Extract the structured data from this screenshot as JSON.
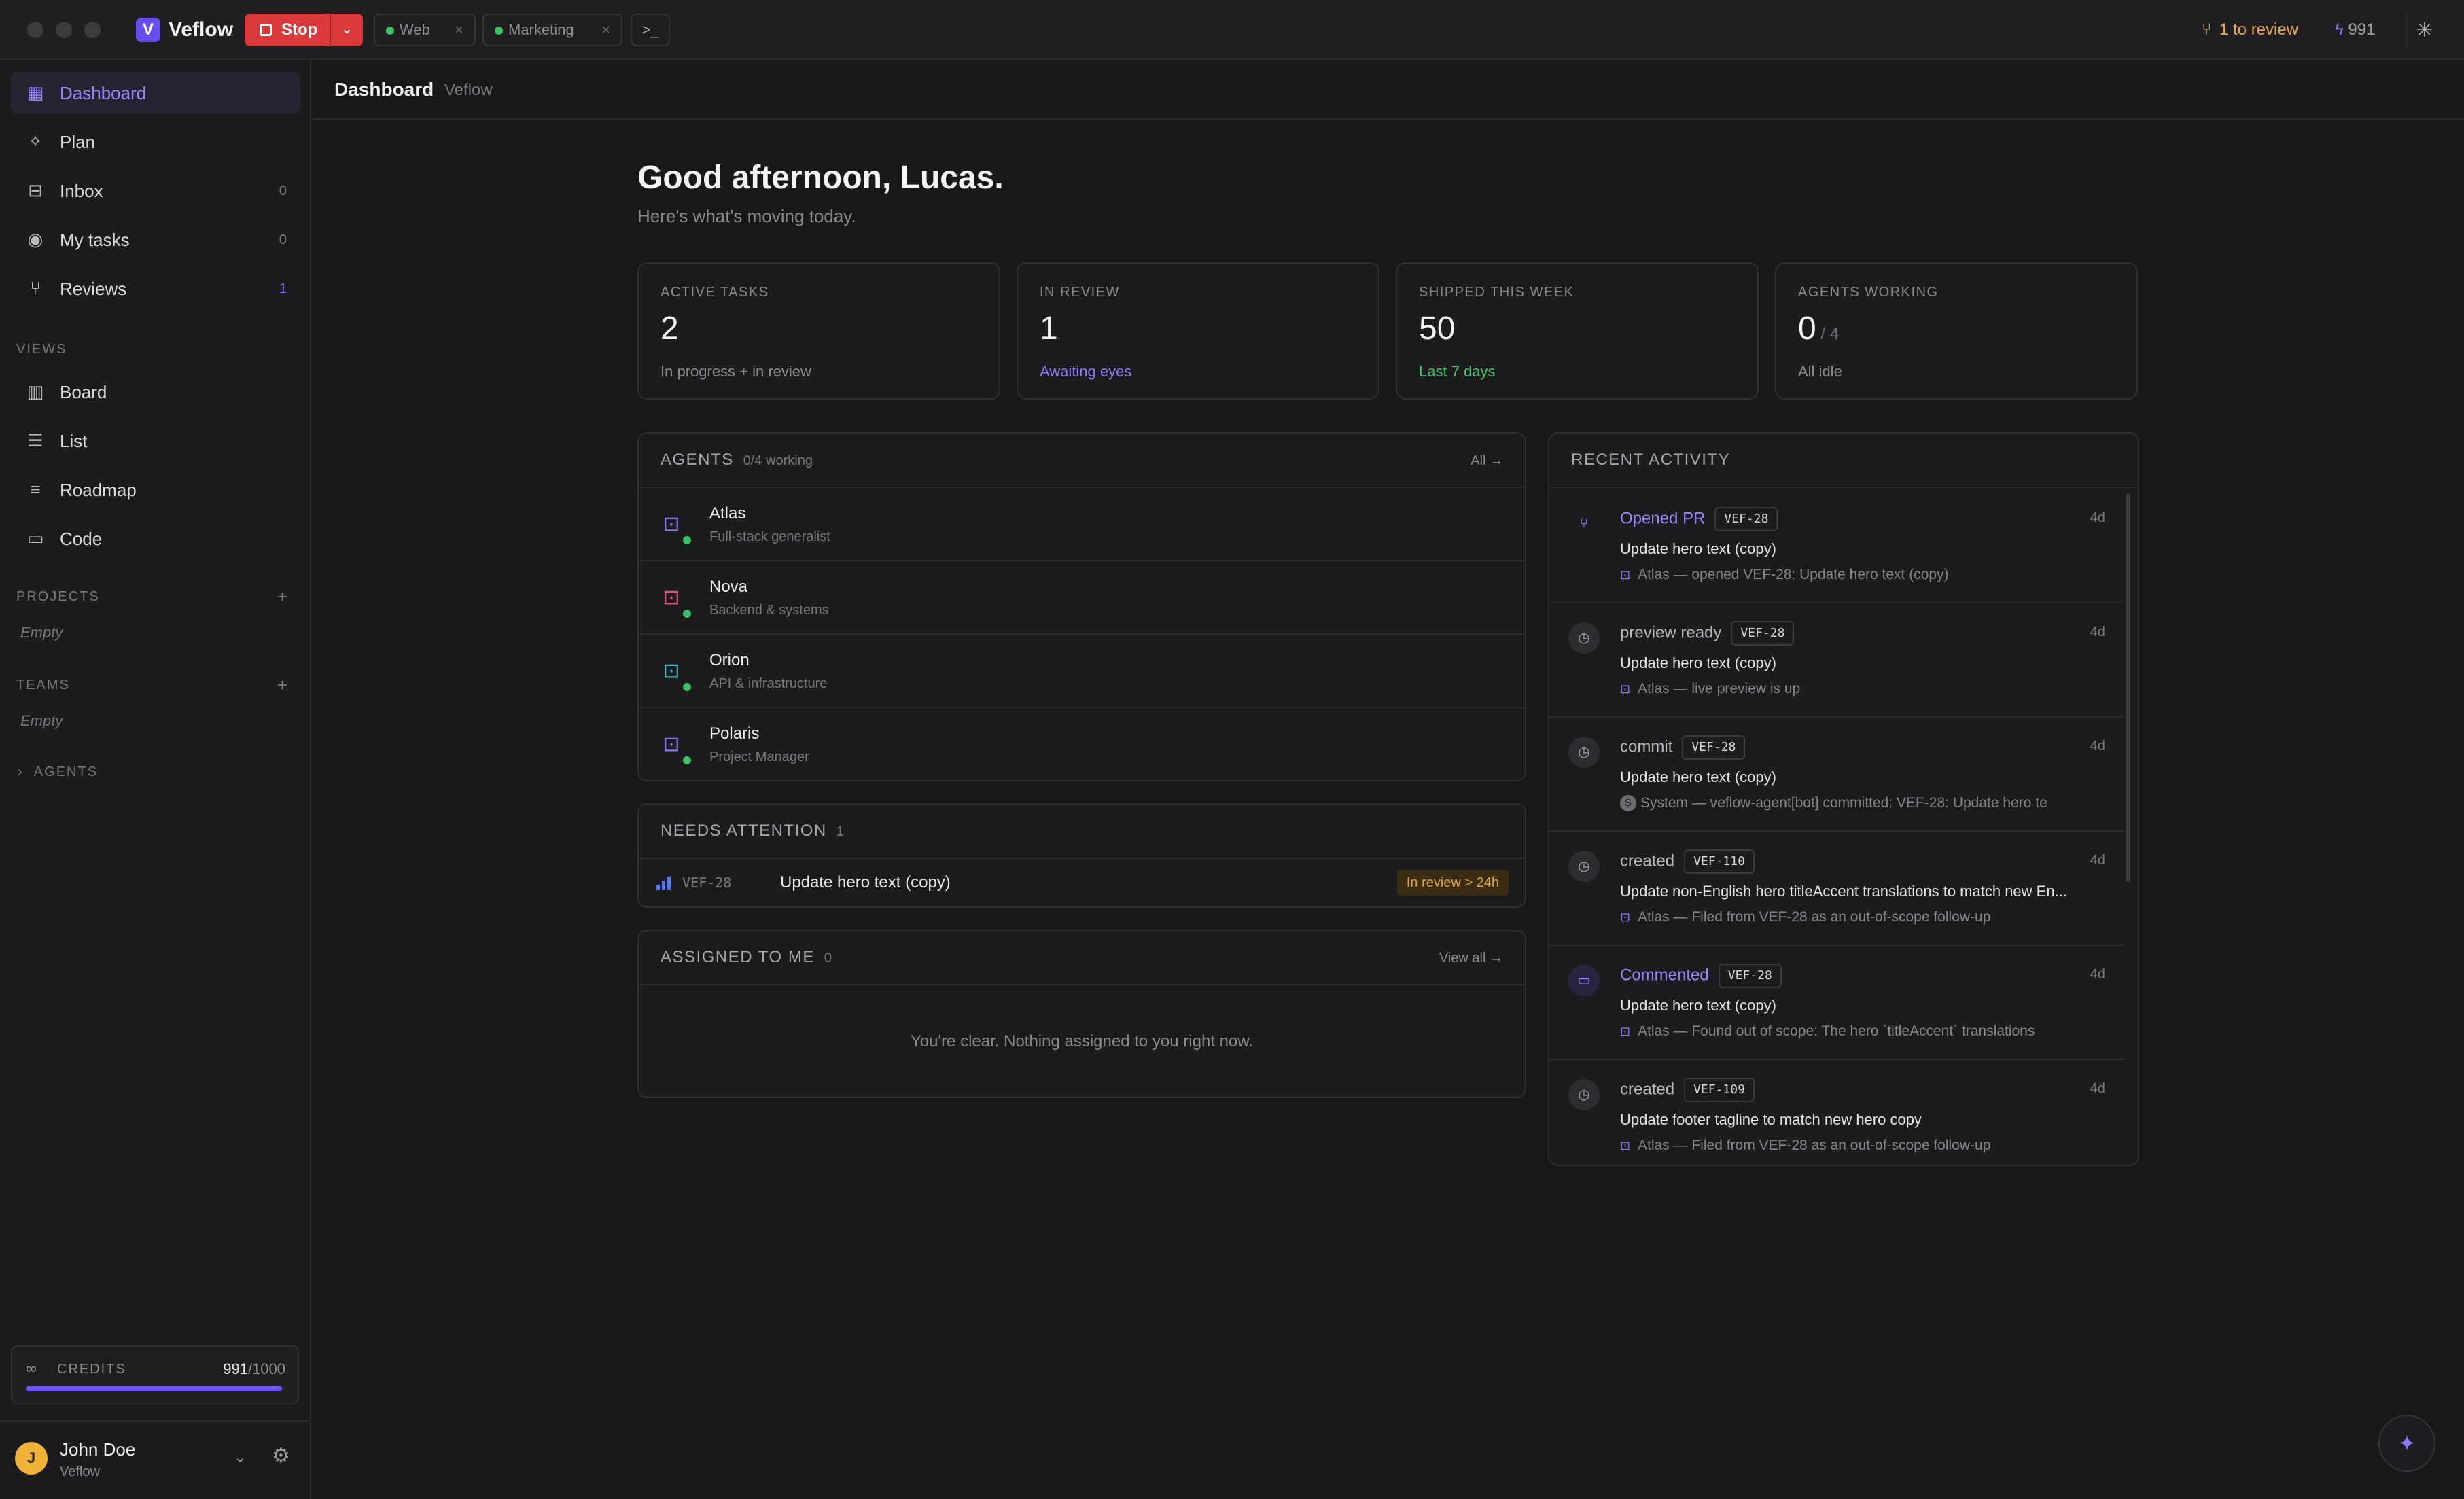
{
  "app": {
    "name": "Veflow",
    "logo_letter": "V",
    "stop_label": "Stop",
    "envs": [
      {
        "label": "Web",
        "status_color": "#3ec165"
      },
      {
        "label": "Marketing",
        "status_color": "#3ec165"
      }
    ],
    "terminal_icon": ">_",
    "review_label": "1 to review",
    "credits_short": "991"
  },
  "sidebar": {
    "nav": [
      {
        "label": "Dashboard",
        "icon": "dashboard-icon",
        "count": "",
        "active": true
      },
      {
        "label": "Plan",
        "icon": "sparkle-icon",
        "count": ""
      },
      {
        "label": "Inbox",
        "icon": "inbox-icon",
        "count": "0"
      },
      {
        "label": "My tasks",
        "icon": "user-circle-icon",
        "count": "0"
      },
      {
        "label": "Reviews",
        "icon": "git-pull-request-icon",
        "count": "1"
      }
    ],
    "views_heading": "VIEWS",
    "views": [
      {
        "label": "Board",
        "icon": "board-icon"
      },
      {
        "label": "List",
        "icon": "list-icon"
      },
      {
        "label": "Roadmap",
        "icon": "roadmap-icon"
      },
      {
        "label": "Code",
        "icon": "code-folder-icon"
      }
    ],
    "projects_heading": "PROJECTS",
    "projects_empty": "Empty",
    "teams_heading": "TEAMS",
    "teams_empty": "Empty",
    "agents_heading": "AGENTS",
    "credits": {
      "label": "CREDITS",
      "used": "991",
      "total": "/1000",
      "fraction": 0.991
    },
    "user": {
      "initial": "J",
      "name": "John Doe",
      "org": "Veflow"
    }
  },
  "breadcrumb": {
    "title": "Dashboard",
    "sub": "Veflow"
  },
  "greeting": {
    "title": "Good afternoon, Lucas.",
    "subtitle": "Here's what's moving today."
  },
  "stats": [
    {
      "label": "ACTIVE TASKS",
      "value": "2",
      "of": "",
      "sub": "In progress + in review",
      "sub_color": "default"
    },
    {
      "label": "IN REVIEW",
      "value": "1",
      "of": "",
      "sub": "Awaiting eyes",
      "sub_color": "purple"
    },
    {
      "label": "SHIPPED THIS WEEK",
      "value": "50",
      "of": "",
      "sub": "Last 7 days",
      "sub_color": "green"
    },
    {
      "label": "AGENTS WORKING",
      "value": "0",
      "of": " / 4",
      "sub": "All idle",
      "sub_color": "default"
    }
  ],
  "agents_panel": {
    "title": "AGENTS",
    "meta": "0/4 working",
    "link": "All →",
    "agents": [
      {
        "name": "Atlas",
        "role": "Full-stack generalist",
        "color": "#8a72f5"
      },
      {
        "name": "Nova",
        "role": "Backend & systems",
        "color": "#e0527a"
      },
      {
        "name": "Orion",
        "role": "API & infrastructure",
        "color": "#3fb7c9"
      },
      {
        "name": "Polaris",
        "role": "Project Manager",
        "color": "#8a72f5"
      }
    ]
  },
  "attention_panel": {
    "title": "NEEDS ATTENTION",
    "count": "1",
    "items": [
      {
        "key": "VEF-28",
        "title": "Update hero text (copy)",
        "badge": "In review > 24h"
      }
    ]
  },
  "assigned_panel": {
    "title": "ASSIGNED TO ME",
    "count": "0",
    "link": "View all →",
    "empty": "You're clear. Nothing assigned to you right now."
  },
  "activity_panel": {
    "title": "RECENT ACTIVITY",
    "items": [
      {
        "type": "Opened PR",
        "type_style": "purple",
        "icon": "git-branch-icon",
        "tag": "VEF-28",
        "time": "4d",
        "title": "Update hero text (copy)",
        "meta": "Atlas — opened VEF-28: Update hero text (copy)",
        "meta_kind": "agent"
      },
      {
        "type": "preview ready",
        "type_style": "default",
        "icon": "clock-icon",
        "tag": "VEF-28",
        "time": "4d",
        "title": "Update hero text (copy)",
        "meta": "Atlas — live preview is up",
        "meta_kind": "agent"
      },
      {
        "type": "commit",
        "type_style": "default",
        "icon": "clock-icon",
        "tag": "VEF-28",
        "time": "4d",
        "title": "Update hero text (copy)",
        "meta": "System — veflow-agent[bot] committed: VEF-28: Update hero te",
        "meta_kind": "system",
        "meta_initial": "S"
      },
      {
        "type": "created",
        "type_style": "default",
        "icon": "clock-icon",
        "tag": "VEF-110",
        "time": "4d",
        "title": "Update non-English hero titleAccent translations to match new En...",
        "meta": "Atlas — Filed from VEF-28 as an out-of-scope follow-up",
        "meta_kind": "agent"
      },
      {
        "type": "Commented",
        "type_style": "purple",
        "icon": "comment-icon",
        "tag": "VEF-28",
        "time": "4d",
        "title": "Update hero text (copy)",
        "meta": "Atlas — Found out of scope: The hero `titleAccent` translations",
        "meta_kind": "agent"
      },
      {
        "type": "created",
        "type_style": "default",
        "icon": "clock-icon",
        "tag": "VEF-109",
        "time": "4d",
        "title": "Update footer tagline to match new hero copy",
        "meta": "Atlas — Filed from VEF-28 as an out-of-scope follow-up",
        "meta_kind": "agent"
      }
    ]
  }
}
